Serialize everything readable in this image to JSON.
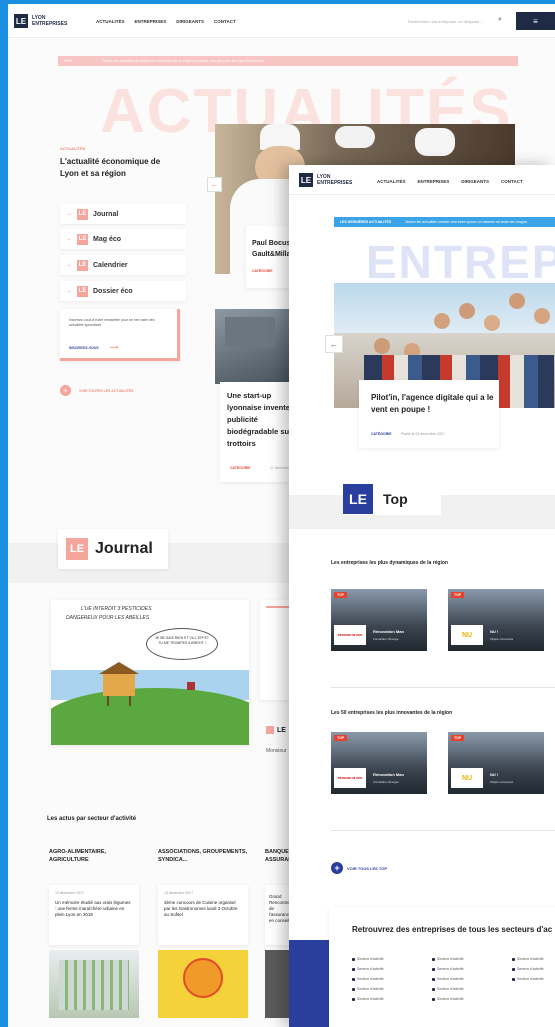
{
  "back": {
    "brand_top": "LYON",
    "brand_bottom": "ENTREPRISES",
    "nav": [
      "ACTUALITÉS",
      "ENTREPRISES",
      "DIRIGEANTS",
      "CONTACT"
    ],
    "search_placeholder": "Recherchez une entreprise, un dirigeant ...",
    "ticker_label": "INFO",
    "ticker_text": "Suivez les actualités de toutes les entreprises de la région lyonnaise, tous les jours sur Lyon Entreprises",
    "big_word": "ACTUALITÉS",
    "kicker": "ACTUALITÉS",
    "intro_title": "L'actualité économique de Lyon et sa région",
    "menu": [
      "Journal",
      "Mag éco",
      "Calendrier",
      "Dossier éco"
    ],
    "newsletter_text": "Inscrivez-vous à notre newsletter pour ne rien rater des actualités lyonnaises",
    "newsletter_cta": "INSCRIVEZ-VOUS",
    "more_news": "VOIR TOUTES LES ACTUALITÉS",
    "feature1_title": "Paul Bocuse ... Gault&Millau",
    "feature1_category": "CATÉGORIE",
    "feature2_title": "Une start-up lyonnaise invente la publicité biodégradable sur les trottoirs",
    "feature2_category": "CATÉGORIE",
    "feature2_date": "21 décembre",
    "journal_title": "Journal",
    "cartoon_line1": "L'UE INTERDIT 3 PESTICIDES",
    "cartoon_line2": "DANGEREUX POUR LES ABEILLES",
    "cartoon_bubble": "JE NE SAIS RIEN ET VU L'EFFET TU ME TROMPES A BREXIT !",
    "side_label": "LE",
    "side_name": "Monsieur",
    "sectors_heading": "Les actus par secteur d'activité",
    "columns": [
      {
        "head": "AGRO-ALIMENTAIRE, AGRICULTURE",
        "date": "13 décembre 2017",
        "text": "Un mémoire étudié aux vrais légumes : une ferme maraîchère urbaine en plein Lyon en 2016"
      },
      {
        "head": "ASSOCIATIONS, GROUPEMENTS, SYNDICA...",
        "date": "13 décembre 2017",
        "text": "3ème concours de Cuisine organisé par les Gastronomes lundi 3 Octobre au Sofitel"
      },
      {
        "head": "BANQUE, ASSURANCE",
        "date": "",
        "text": "Grand Rencontre de l'assurance en conseil"
      }
    ]
  },
  "front": {
    "brand_top": "LYON",
    "brand_bottom": "ENTREPRISES",
    "nav": [
      "ACTUALITÉS",
      "ENTREPRISES",
      "DIRIGEANTS",
      "CONTACT"
    ],
    "ticker_label": "LES DERNIÈRES ACTUALITÉS",
    "ticker_text": "Suivez les actualités comme cela lorem ipsum on dolorem sit amet nec magna",
    "big_word": "ENTREPRISES",
    "slide_title": "Pilot'in, l'agence digitale qui a le vent en poupe !",
    "slide_category": "CATÉGORIE",
    "slide_date": "Publié le 24 décembre 2017",
    "top_logo": "LE",
    "top_title": "Top",
    "section1": "Les entreprises les plus dynamiques de la région",
    "section2": "Les 50 entreprises les plus innovantes de la région",
    "tiles1": [
      {
        "rank": "TOP",
        "logo": "PÉRIGOR NI SOS",
        "name": "Rénovation Man",
        "sub": "Immobilier, Énergie"
      },
      {
        "rank": "TOP",
        "logo": "NU",
        "name": "NU !",
        "sub": "Objets connectés"
      }
    ],
    "tiles2": [
      {
        "rank": "TOP",
        "logo": "PÉRIGOR NI SOS",
        "name": "Rénovation Man",
        "sub": "Immobilier, Énergie"
      },
      {
        "rank": "TOP",
        "logo": "NU",
        "name": "NU !",
        "sub": "Objets connectés"
      }
    ],
    "see_all": "VOIR TOUS LES TOP",
    "sectors_heading": "Retrouvrez des entreprises de tous les secteurs d'ac",
    "sector_item": "Secteur d'activité"
  },
  "colors": {
    "brand_navy": "#1f2a44",
    "salmon": "#f4a59c",
    "accent_blue": "#2a3e9e",
    "tick_blue": "#3ba3e8"
  }
}
